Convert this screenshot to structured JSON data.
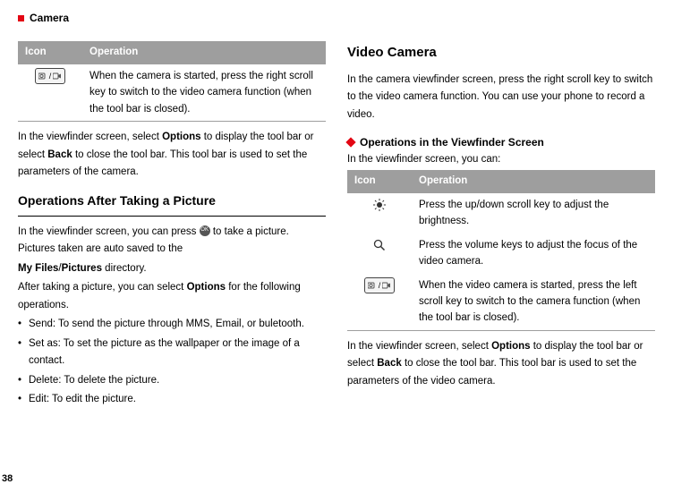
{
  "header": {
    "title": "Camera"
  },
  "page_number": "38",
  "left": {
    "table": {
      "col_icon": "Icon",
      "col_op": "Operation",
      "row1_op": "When the camera is started, press the right scroll key to switch to the video camera function (when the tool bar is closed)."
    },
    "para1_pre": "In the viewfinder screen, select ",
    "para1_b1": "Options",
    "para1_mid": " to display the tool bar or select ",
    "para1_b2": "Back",
    "para1_post": " to close the tool bar. This tool bar is used to set the parameters of the camera.",
    "h2": "Operations After Taking a Picture",
    "p2_pre": "In the viewfinder screen, you can press ",
    "p2_post": " to take a picture. Pictures taken are auto saved to the",
    "p2_dir_a": "My Files",
    "p2_dir_slash": "/",
    "p2_dir_b": "Pictures",
    "p2_dir_post": " directory.",
    "p3_pre": "After taking a picture, you can select ",
    "p3_b": "Options",
    "p3_post": " for the following operations.",
    "bullets": [
      "Send: To send the picture through MMS, Email, or buletooth.",
      "Set as: To set the picture as the wallpaper or the image of a contact.",
      "Delete: To delete the picture.",
      "Edit: To edit the picture."
    ]
  },
  "right": {
    "h2": "Video Camera",
    "p1": "In the camera viewfinder screen, press the right scroll key to switch to the video camera function. You can use your phone to record a video.",
    "subhead": "Operations in the Viewfinder Screen",
    "p2": "In the viewfinder screen, you can:",
    "table": {
      "col_icon": "Icon",
      "col_op": "Operation",
      "row1_op": "Press the up/down scroll key to adjust the brightness.",
      "row2_op": " Press the volume keys to adjust the focus of the video camera.",
      "row3_op": "When the video camera is started, press the left scroll key to switch to the camera function (when the tool bar is closed)."
    },
    "p3_pre": "In the viewfinder screen, select ",
    "p3_b1": "Options",
    "p3_mid": " to display the tool bar or select ",
    "p3_b2": "Back",
    "p3_post": " to close the tool bar. This tool bar is used to set the parameters of the video camera."
  }
}
